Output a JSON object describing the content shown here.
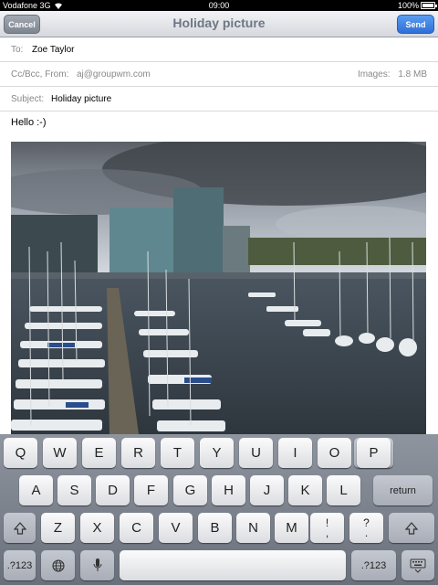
{
  "status": {
    "carrier": "Vodafone 3G",
    "time": "09:00",
    "battery": "100%",
    "battery_level": 1.0
  },
  "nav": {
    "title": "Holiday picture",
    "cancel_label": "Cancel",
    "send_label": "Send"
  },
  "fields": {
    "to_label": "To:",
    "to_value": "Zoe Taylor",
    "ccbcc_label": "Cc/Bcc, From:",
    "from_value": "aj@groupwm.com",
    "images_label": "Images:",
    "images_value": "1.8 MB",
    "subject_label": "Subject:",
    "subject_value": "Holiday picture"
  },
  "body": {
    "text": "Hello :-)"
  },
  "attachment": {
    "icon": "harbour-photo"
  },
  "keyboard": {
    "row1": [
      "Q",
      "W",
      "E",
      "R",
      "T",
      "Y",
      "U",
      "I",
      "O",
      "P"
    ],
    "row2": [
      "A",
      "S",
      "D",
      "F",
      "G",
      "H",
      "J",
      "K",
      "L"
    ],
    "row3": [
      "Z",
      "X",
      "C",
      "V",
      "B",
      "N",
      "M"
    ],
    "return_label": "return",
    "num_label": ".?123",
    "excl_top": "!",
    "excl_bottom": ",",
    "ques_top": "?",
    "ques_bottom": "."
  },
  "colors": {
    "send": "#2f6fd6",
    "keyboard_bg": "#7b818c"
  }
}
